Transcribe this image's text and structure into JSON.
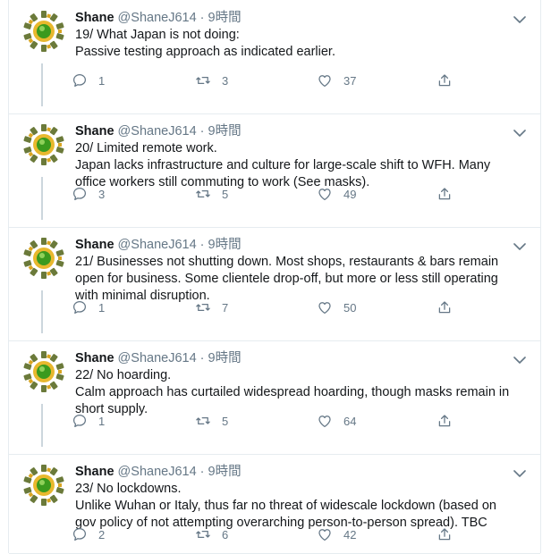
{
  "tweets": [
    {
      "name": "Shane",
      "handle": "@ShaneJ614",
      "separator": "·",
      "time": "9時間",
      "lines": [
        "19/ What Japan is not doing:",
        "Passive testing approach as indicated earlier."
      ],
      "replies": "1",
      "retweets": "3",
      "likes": "37"
    },
    {
      "name": "Shane",
      "handle": "@ShaneJ614",
      "separator": "·",
      "time": "9時間",
      "lines": [
        "20/ Limited remote work.",
        "Japan lacks infrastructure and culture for large-scale shift to WFH. Many",
        "office workers still commuting to work (See masks)."
      ],
      "replies": "3",
      "retweets": "5",
      "likes": "49"
    },
    {
      "name": "Shane",
      "handle": "@ShaneJ614",
      "separator": "·",
      "time": "9時間",
      "lines": [
        "21/ Businesses not shutting down. Most shops, restaurants & bars remain",
        "open for business. Some clientele drop-off, but more or less still operating",
        "with minimal disruption."
      ],
      "replies": "1",
      "retweets": "7",
      "likes": "50"
    },
    {
      "name": "Shane",
      "handle": "@ShaneJ614",
      "separator": "·",
      "time": "9時間",
      "lines": [
        "22/ No hoarding.",
        "Calm approach has curtailed widespread hoarding, though masks remain in",
        "short supply."
      ],
      "replies": "1",
      "retweets": "5",
      "likes": "64"
    },
    {
      "name": "Shane",
      "handle": "@ShaneJ614",
      "separator": "·",
      "time": "9時間",
      "lines": [
        "23/ No lockdowns.",
        "Unlike Wuhan or Italy, thus far no threat of widescale lockdown (based on",
        "gov policy of not attempting overarching person-to-person spread). TBC"
      ],
      "replies": "2",
      "retweets": "6",
      "likes": "42"
    }
  ],
  "icons": {
    "reply": "reply-icon",
    "retweet": "retweet-icon",
    "like": "heart-icon",
    "share": "share-icon",
    "caret": "chevron-down-icon",
    "avatar": "avatar"
  },
  "colors": {
    "text": "#14171a",
    "secondary": "#657786",
    "divider": "#e6ecf0",
    "thread_line": "#ccd6dd",
    "avatar_green": "#3a7d1e",
    "avatar_yellow": "#e8b82e"
  }
}
